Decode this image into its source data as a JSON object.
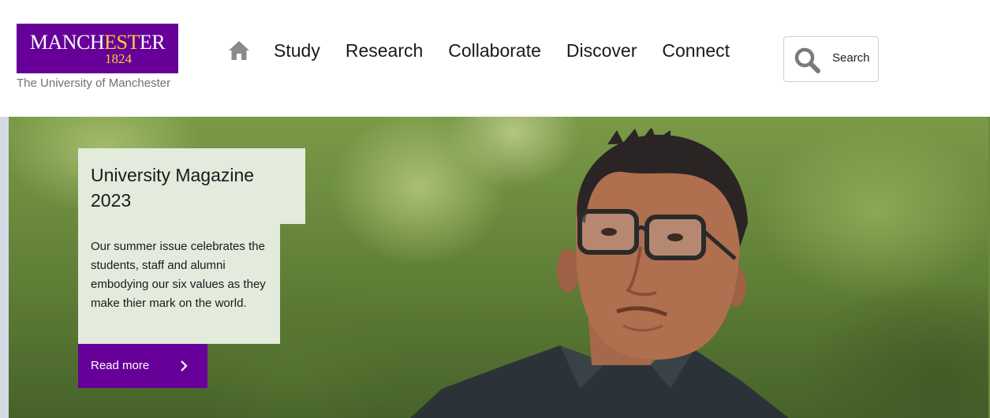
{
  "header": {
    "logo": {
      "word_start": "MANCH",
      "word_mid": "EST",
      "word_end": "ER",
      "year": "1824",
      "subtitle": "The University of Manchester"
    },
    "nav": {
      "home_icon": "home-icon",
      "items": [
        "Study",
        "Research",
        "Collaborate",
        "Discover",
        "Connect"
      ]
    },
    "search": {
      "label": "Search",
      "icon": "search-icon"
    }
  },
  "hero": {
    "title": "University Magazine 2023",
    "body": "Our summer issue celebrates the students, staff and alumni embodying our six values as they make thier mark on the world.",
    "cta_label": "Read more",
    "cta_icon": "chevron-right-icon"
  },
  "colors": {
    "brand_purple": "#660099",
    "brand_gold": "#ffcc33",
    "card_background": "#e3ebdd"
  }
}
